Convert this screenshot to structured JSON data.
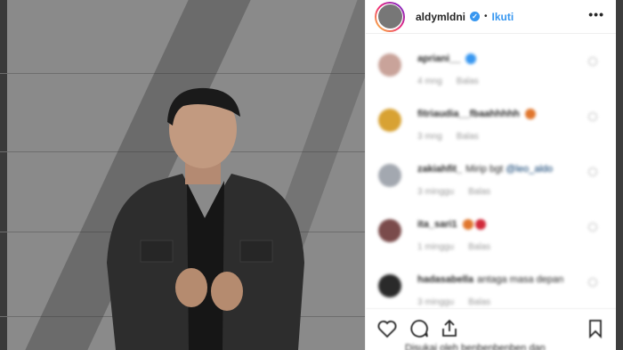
{
  "post": {
    "username": "aldymldni",
    "verified_mark": "✓",
    "separator": "•",
    "follow_label": "Ikuti",
    "more_label": "•••"
  },
  "comments": [
    {
      "user": "apriani__",
      "text": "",
      "emoji_color": "#3897f0",
      "time": "4 mng",
      "reply": "Balas",
      "avatar_color": "#c9a39a"
    },
    {
      "user": "fitriaudia__fbaahhhhh",
      "text": "",
      "emoji_color": "#e0762d",
      "time": "3 mng",
      "reply": "Balas",
      "avatar_color": "#d8a233"
    },
    {
      "user": "zakiahfit_",
      "text": "Mirip bgt ",
      "mention": "@leo_aldo",
      "emoji_color": "",
      "time": "3 minggu",
      "reply": "Balas",
      "avatar_color": "#a3a8b0"
    },
    {
      "user": "ita_sari1",
      "text": "",
      "emoji_color": "#e0762d",
      "emoji2_color": "#d12a3a",
      "time": "1 minggu",
      "reply": "Balas",
      "avatar_color": "#7a4b4b"
    },
    {
      "user": "hadasabella",
      "text": "antaga masa depan",
      "emoji_color": "",
      "time": "3 minggu",
      "reply": "Balas",
      "avatar_color": "#2a2a2a"
    }
  ],
  "footer": {
    "liked_by": "Disukai oleh benbenbenben dan"
  },
  "icons": {
    "heart": "heart-icon",
    "comment": "comment-icon",
    "share": "share-icon",
    "bookmark": "bookmark-icon"
  },
  "colors": {
    "accent": "#3897f0",
    "text": "#262626",
    "muted": "#999999"
  }
}
